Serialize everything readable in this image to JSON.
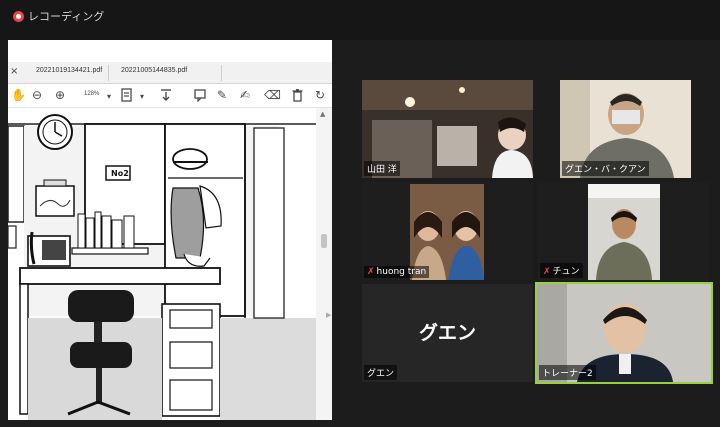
{
  "recording": {
    "label": "レコーディング"
  },
  "pdf": {
    "tab_close": "×",
    "tabs": [
      "20221019134421.pdf",
      "20221005144835.pdf"
    ],
    "zoom": "128%",
    "toolbar_icons": [
      "hand-icon",
      "zoom-out-icon",
      "zoom-in-icon",
      "fit-page-icon",
      "download-icon",
      "comment-icon",
      "draw-icon",
      "sign-icon",
      "erase-icon",
      "delete-icon",
      "rotate-icon"
    ],
    "illustration": {
      "cabinet_label": "No2"
    }
  },
  "participants": [
    {
      "name": "山田 洋",
      "muted": false
    },
    {
      "name": "グエン・バ・クアン",
      "muted": false
    },
    {
      "name": "huong tran",
      "muted": true
    },
    {
      "name": "チュン",
      "muted": true
    },
    {
      "name": "グエン",
      "muted": false,
      "display_name": "グエン",
      "video_off": true
    },
    {
      "name": "トレーナー2",
      "muted": false,
      "active_speaker": true
    }
  ],
  "colors": {
    "active_speaker_border": "#9ad03e",
    "muted_icon": "#ee4444",
    "record_dot": "#e8444c"
  }
}
